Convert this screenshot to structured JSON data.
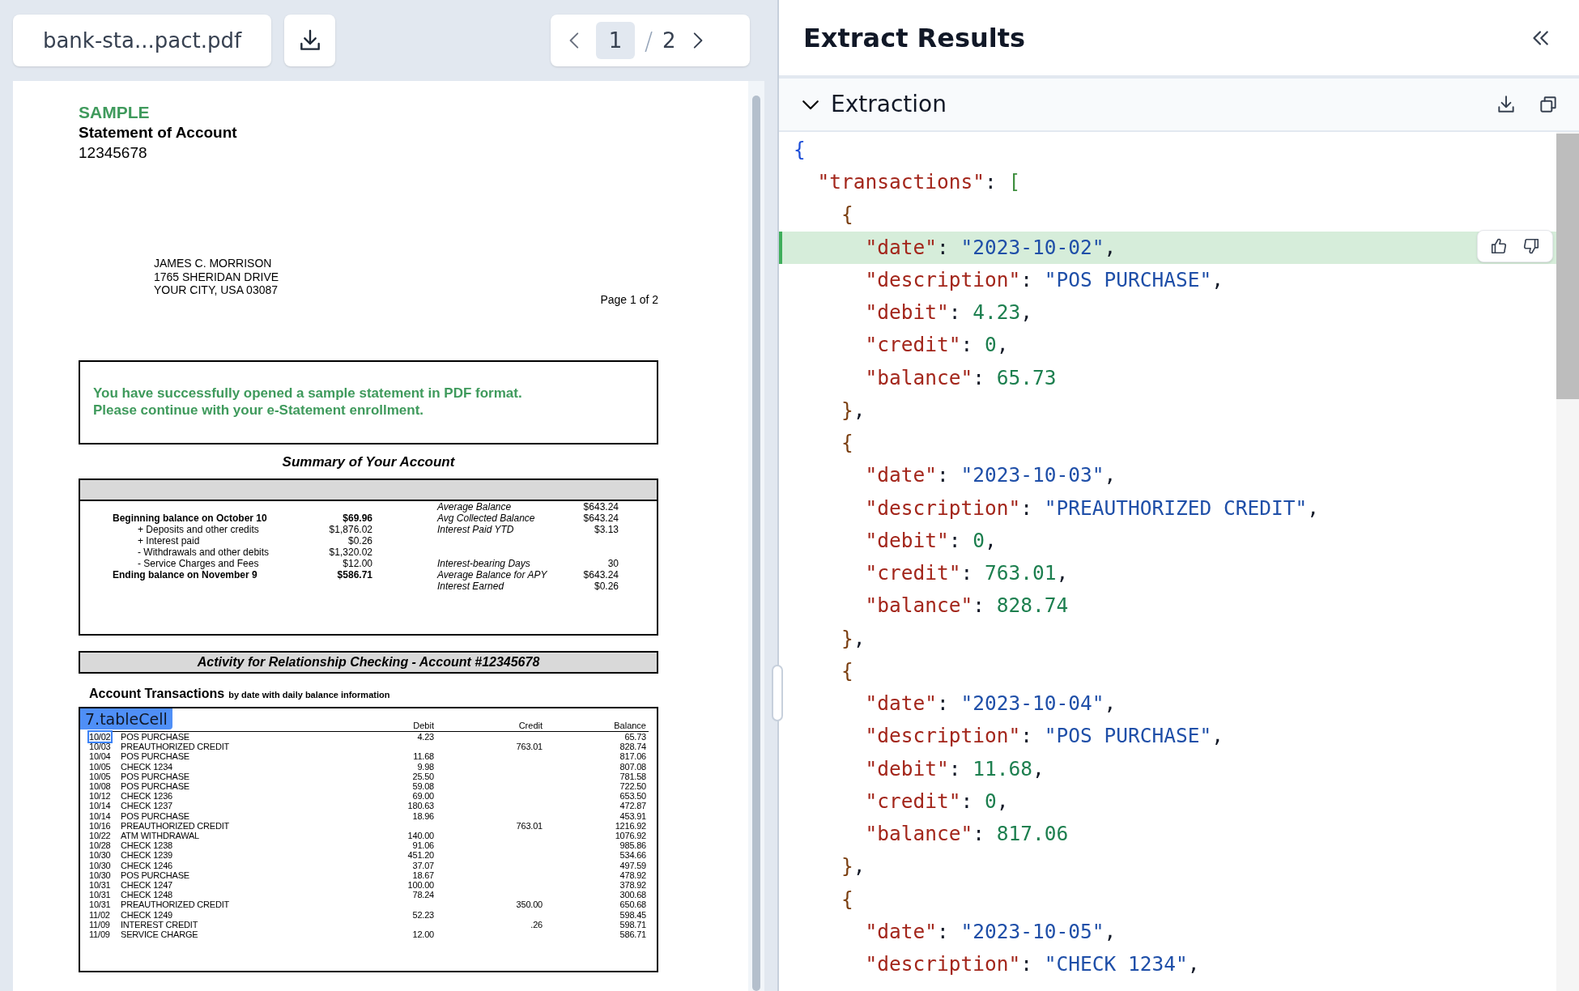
{
  "viewer": {
    "file_name": "bank-sta...pact.pdf",
    "pager": {
      "current": "1",
      "separator": "/",
      "total": "2"
    }
  },
  "document": {
    "sample_label": "SAMPLE",
    "title": "Statement of Account",
    "account_number": "12345678",
    "address": [
      "JAMES C. MORRISON",
      "1765 SHERIDAN DRIVE",
      "YOUR CITY, USA 03087"
    ],
    "page_label": "Page 1 of 2",
    "notice": [
      "You have successfully opened a sample statement in PDF format.",
      "Please continue with your e-Statement enrollment."
    ],
    "summary": {
      "title": "Summary of Your Account",
      "rows": [
        {
          "side_label": "Average Balance",
          "side_amount": "$643.24"
        },
        {
          "kind": "total",
          "label": "Beginning balance on October 10",
          "amount": "$69.96",
          "side_label": "Avg Collected Balance",
          "side_amount": "$643.24"
        },
        {
          "kind": "item",
          "label": "+ Deposits and other credits",
          "amount": "$1,876.02",
          "side_label": "Interest Paid YTD",
          "side_amount": "$3.13"
        },
        {
          "kind": "item",
          "label": "+ Interest paid",
          "amount": "$0.26"
        },
        {
          "kind": "item",
          "label": "- Withdrawals and other debits",
          "amount": "$1,320.02"
        },
        {
          "kind": "item",
          "label": "- Service Charges and Fees",
          "amount": "$12.00",
          "side_label": "Interest-bearing Days",
          "side_amount": "30"
        },
        {
          "kind": "total",
          "label": "Ending balance on November 9",
          "amount": "$586.71",
          "side_label": "Average Balance for APY",
          "side_amount": "$643.24"
        },
        {
          "side_label": "Interest Earned",
          "side_amount": "$0.26"
        }
      ]
    },
    "activity_title": "Activity for Relationship Checking - Account #12345678",
    "transactions_title": "Account Transactions",
    "transactions_subtitle": "by date with daily balance information",
    "cell_highlight": {
      "label": "7.tableCell"
    },
    "columns": [
      "Debit",
      "Credit",
      "Balance"
    ],
    "rows": [
      {
        "date": "10/02",
        "description": "POS PURCHASE",
        "debit": "4.23",
        "balance": "65.73"
      },
      {
        "date": "10/03",
        "description": "PREAUTHORIZED CREDIT",
        "credit": "763.01",
        "balance": "828.74"
      },
      {
        "date": "10/04",
        "description": "POS PURCHASE",
        "debit": "11.68",
        "balance": "817.06"
      },
      {
        "date": "10/05",
        "description": "CHECK 1234",
        "debit": "9.98",
        "balance": "807.08"
      },
      {
        "date": "10/05",
        "description": "POS PURCHASE",
        "debit": "25.50",
        "balance": "781.58"
      },
      {
        "date": "10/08",
        "description": "POS PURCHASE",
        "debit": "59.08",
        "balance": "722.50"
      },
      {
        "date": "10/12",
        "description": "CHECK 1236",
        "debit": "69.00",
        "balance": "653.50"
      },
      {
        "date": "10/14",
        "description": "CHECK 1237",
        "debit": "180.63",
        "balance": "472.87"
      },
      {
        "date": "10/14",
        "description": "POS PURCHASE",
        "debit": "18.96",
        "balance": "453.91"
      },
      {
        "date": "10/16",
        "description": "PREAUTHORIZED CREDIT",
        "credit": "763.01",
        "balance": "1216.92"
      },
      {
        "date": "10/22",
        "description": "ATM WITHDRAWAL",
        "debit": "140.00",
        "balance": "1076.92"
      },
      {
        "date": "10/28",
        "description": "CHECK 1238",
        "debit": "91.06",
        "balance": "985.86"
      },
      {
        "date": "10/30",
        "description": "CHECK 1239",
        "debit": "451.20",
        "balance": "534.66"
      },
      {
        "date": "10/30",
        "description": "CHECK 1246",
        "debit": "37.07",
        "balance": "497.59"
      },
      {
        "date": "10/30",
        "description": "POS PURCHASE",
        "debit": "18.67",
        "balance": "478.92"
      },
      {
        "date": "10/31",
        "description": "CHECK 1247",
        "debit": "100.00",
        "balance": "378.92"
      },
      {
        "date": "10/31",
        "description": "CHECK 1248",
        "debit": "78.24",
        "balance": "300.68"
      },
      {
        "date": "10/31",
        "description": "PREAUTHORIZED CREDIT",
        "credit": "350.00",
        "balance": "650.68"
      },
      {
        "date": "11/02",
        "description": "CHECK 1249",
        "debit": "52.23",
        "balance": "598.45"
      },
      {
        "date": "11/09",
        "description": "INTEREST CREDIT",
        "credit": ".26",
        "balance": "598.71"
      },
      {
        "date": "11/09",
        "description": "SERVICE CHARGE",
        "debit": "12.00",
        "balance": "586.71"
      }
    ]
  },
  "results": {
    "title": "Extract Results",
    "section": {
      "title": "Extraction",
      "expanded": true
    },
    "code": [
      {
        "highlighted": false,
        "tokens": [
          {
            "kind": "brace_root",
            "text": "{"
          }
        ],
        "children": [
          {
            "highlighted": false,
            "tokens": [
              {
                "kind": "key",
                "text": "\"transactions\""
              },
              {
                "kind": "punct",
                "text": ": "
              },
              {
                "kind": "bracket",
                "text": "["
              }
            ],
            "children": [
              {
                "highlighted": false,
                "tokens": [
                  {
                    "kind": "brace",
                    "text": "{"
                  }
                ],
                "children": [
                  {
                    "highlighted": true,
                    "tokens": [
                      {
                        "kind": "key",
                        "text": "\"date\""
                      },
                      {
                        "kind": "punct",
                        "text": ": "
                      },
                      {
                        "kind": "string",
                        "text": "\"2023-10-02\""
                      },
                      {
                        "kind": "punct",
                        "text": ","
                      }
                    ]
                  },
                  {
                    "highlighted": false,
                    "tokens": [
                      {
                        "kind": "key",
                        "text": "\"description\""
                      },
                      {
                        "kind": "punct",
                        "text": ": "
                      },
                      {
                        "kind": "string",
                        "text": "\"POS PURCHASE\""
                      },
                      {
                        "kind": "punct",
                        "text": ","
                      }
                    ]
                  },
                  {
                    "highlighted": false,
                    "tokens": [
                      {
                        "kind": "key",
                        "text": "\"debit\""
                      },
                      {
                        "kind": "punct",
                        "text": ": "
                      },
                      {
                        "kind": "number",
                        "text": "4.23"
                      },
                      {
                        "kind": "punct",
                        "text": ","
                      }
                    ]
                  },
                  {
                    "highlighted": false,
                    "tokens": [
                      {
                        "kind": "key",
                        "text": "\"credit\""
                      },
                      {
                        "kind": "punct",
                        "text": ": "
                      },
                      {
                        "kind": "number",
                        "text": "0"
                      },
                      {
                        "kind": "punct",
                        "text": ","
                      }
                    ]
                  },
                  {
                    "highlighted": false,
                    "tokens": [
                      {
                        "kind": "key",
                        "text": "\"balance\""
                      },
                      {
                        "kind": "punct",
                        "text": ": "
                      },
                      {
                        "kind": "number",
                        "text": "65.73"
                      }
                    ]
                  }
                ]
              },
              {
                "highlighted": false,
                "tokens": [
                  {
                    "kind": "brace",
                    "text": "}"
                  },
                  {
                    "kind": "punct",
                    "text": ","
                  }
                ]
              },
              {
                "highlighted": false,
                "tokens": [
                  {
                    "kind": "brace",
                    "text": "{"
                  }
                ],
                "children": [
                  {
                    "highlighted": false,
                    "tokens": [
                      {
                        "kind": "key",
                        "text": "\"date\""
                      },
                      {
                        "kind": "punct",
                        "text": ": "
                      },
                      {
                        "kind": "string",
                        "text": "\"2023-10-03\""
                      },
                      {
                        "kind": "punct",
                        "text": ","
                      }
                    ]
                  },
                  {
                    "highlighted": false,
                    "tokens": [
                      {
                        "kind": "key",
                        "text": "\"description\""
                      },
                      {
                        "kind": "punct",
                        "text": ": "
                      },
                      {
                        "kind": "string",
                        "text": "\"PREAUTHORIZED CREDIT\""
                      },
                      {
                        "kind": "punct",
                        "text": ","
                      }
                    ]
                  },
                  {
                    "highlighted": false,
                    "tokens": [
                      {
                        "kind": "key",
                        "text": "\"debit\""
                      },
                      {
                        "kind": "punct",
                        "text": ": "
                      },
                      {
                        "kind": "number",
                        "text": "0"
                      },
                      {
                        "kind": "punct",
                        "text": ","
                      }
                    ]
                  },
                  {
                    "highlighted": false,
                    "tokens": [
                      {
                        "kind": "key",
                        "text": "\"credit\""
                      },
                      {
                        "kind": "punct",
                        "text": ": "
                      },
                      {
                        "kind": "number",
                        "text": "763.01"
                      },
                      {
                        "kind": "punct",
                        "text": ","
                      }
                    ]
                  },
                  {
                    "highlighted": false,
                    "tokens": [
                      {
                        "kind": "key",
                        "text": "\"balance\""
                      },
                      {
                        "kind": "punct",
                        "text": ": "
                      },
                      {
                        "kind": "number",
                        "text": "828.74"
                      }
                    ]
                  }
                ]
              },
              {
                "highlighted": false,
                "tokens": [
                  {
                    "kind": "brace",
                    "text": "}"
                  },
                  {
                    "kind": "punct",
                    "text": ","
                  }
                ]
              },
              {
                "highlighted": false,
                "tokens": [
                  {
                    "kind": "brace",
                    "text": "{"
                  }
                ],
                "children": [
                  {
                    "highlighted": false,
                    "tokens": [
                      {
                        "kind": "key",
                        "text": "\"date\""
                      },
                      {
                        "kind": "punct",
                        "text": ": "
                      },
                      {
                        "kind": "string",
                        "text": "\"2023-10-04\""
                      },
                      {
                        "kind": "punct",
                        "text": ","
                      }
                    ]
                  },
                  {
                    "highlighted": false,
                    "tokens": [
                      {
                        "kind": "key",
                        "text": "\"description\""
                      },
                      {
                        "kind": "punct",
                        "text": ": "
                      },
                      {
                        "kind": "string",
                        "text": "\"POS PURCHASE\""
                      },
                      {
                        "kind": "punct",
                        "text": ","
                      }
                    ]
                  },
                  {
                    "highlighted": false,
                    "tokens": [
                      {
                        "kind": "key",
                        "text": "\"debit\""
                      },
                      {
                        "kind": "punct",
                        "text": ": "
                      },
                      {
                        "kind": "number",
                        "text": "11.68"
                      },
                      {
                        "kind": "punct",
                        "text": ","
                      }
                    ]
                  },
                  {
                    "highlighted": false,
                    "tokens": [
                      {
                        "kind": "key",
                        "text": "\"credit\""
                      },
                      {
                        "kind": "punct",
                        "text": ": "
                      },
                      {
                        "kind": "number",
                        "text": "0"
                      },
                      {
                        "kind": "punct",
                        "text": ","
                      }
                    ]
                  },
                  {
                    "highlighted": false,
                    "tokens": [
                      {
                        "kind": "key",
                        "text": "\"balance\""
                      },
                      {
                        "kind": "punct",
                        "text": ": "
                      },
                      {
                        "kind": "number",
                        "text": "817.06"
                      }
                    ]
                  }
                ]
              },
              {
                "highlighted": false,
                "tokens": [
                  {
                    "kind": "brace",
                    "text": "}"
                  },
                  {
                    "kind": "punct",
                    "text": ","
                  }
                ]
              },
              {
                "highlighted": false,
                "tokens": [
                  {
                    "kind": "brace",
                    "text": "{"
                  }
                ],
                "children": [
                  {
                    "highlighted": false,
                    "tokens": [
                      {
                        "kind": "key",
                        "text": "\"date\""
                      },
                      {
                        "kind": "punct",
                        "text": ": "
                      },
                      {
                        "kind": "string",
                        "text": "\"2023-10-05\""
                      },
                      {
                        "kind": "punct",
                        "text": ","
                      }
                    ]
                  },
                  {
                    "highlighted": false,
                    "tokens": [
                      {
                        "kind": "key",
                        "text": "\"description\""
                      },
                      {
                        "kind": "punct",
                        "text": ": "
                      },
                      {
                        "kind": "string",
                        "text": "\"CHECK 1234\""
                      },
                      {
                        "kind": "punct",
                        "text": ","
                      }
                    ]
                  }
                ]
              }
            ]
          }
        ]
      }
    ]
  }
}
